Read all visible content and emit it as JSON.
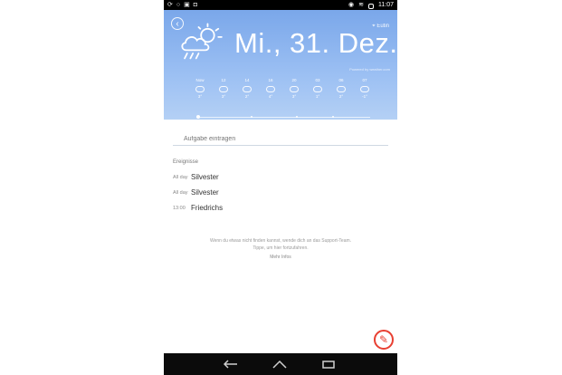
{
  "statusbar": {
    "time": "11:07",
    "left_icons": [
      "sync-icon",
      "circle-icon",
      "image-icon",
      "camera-icon"
    ],
    "right_icons": [
      "location-icon",
      "wifi-icon",
      "battery-icon"
    ]
  },
  "header": {
    "back_icon": "back-icon",
    "place": "Eutin",
    "date": "Mi., 31. Dez.",
    "source": "Powered by weather.com",
    "colors": {
      "sky": "#7aa7ea",
      "sky_light": "#b4d0f5"
    }
  },
  "forecast": {
    "items": [
      {
        "day": "Now",
        "icon": "partly-cloudy-icon",
        "temp": "3°",
        "low": ""
      },
      {
        "day": "12",
        "icon": "partly-cloudy-icon",
        "temp": "3°",
        "low": ""
      },
      {
        "day": "14",
        "icon": "cloud-icon",
        "temp": "2°",
        "low": ""
      },
      {
        "day": "16",
        "icon": "cloud-icon",
        "temp": "4°",
        "low": ""
      },
      {
        "day": "20",
        "icon": "cloud-icon",
        "temp": "3°",
        "low": ""
      },
      {
        "day": "03",
        "icon": "cloud-icon",
        "temp": "1°",
        "low": ""
      },
      {
        "day": "06",
        "icon": "cloud-icon",
        "temp": "2°",
        "low": ""
      },
      {
        "day": "07",
        "icon": "cloud-icon",
        "temp": "-1°",
        "low": ""
      }
    ]
  },
  "task_input": {
    "placeholder": "Aufgabe eintragen"
  },
  "tasks": {
    "section_title": "Ereignisse",
    "items": [
      {
        "time": "All day",
        "name": "Silvester"
      },
      {
        "time": "All day",
        "name": "Silvester"
      },
      {
        "time": "13:00",
        "name": "Friedrichs"
      }
    ]
  },
  "footer": {
    "line1": "Wenn du etwas nicht finden kannst, wende dich an das Support-Team.",
    "line2": "Tippe, um hier fortzufahren.",
    "more": "Mehr Infos"
  },
  "fab": {
    "icon": "edit-icon",
    "color": "#e84032"
  },
  "navbar": {
    "back": "back-nav-icon",
    "home": "home-nav-icon",
    "recent": "recent-apps-icon"
  }
}
